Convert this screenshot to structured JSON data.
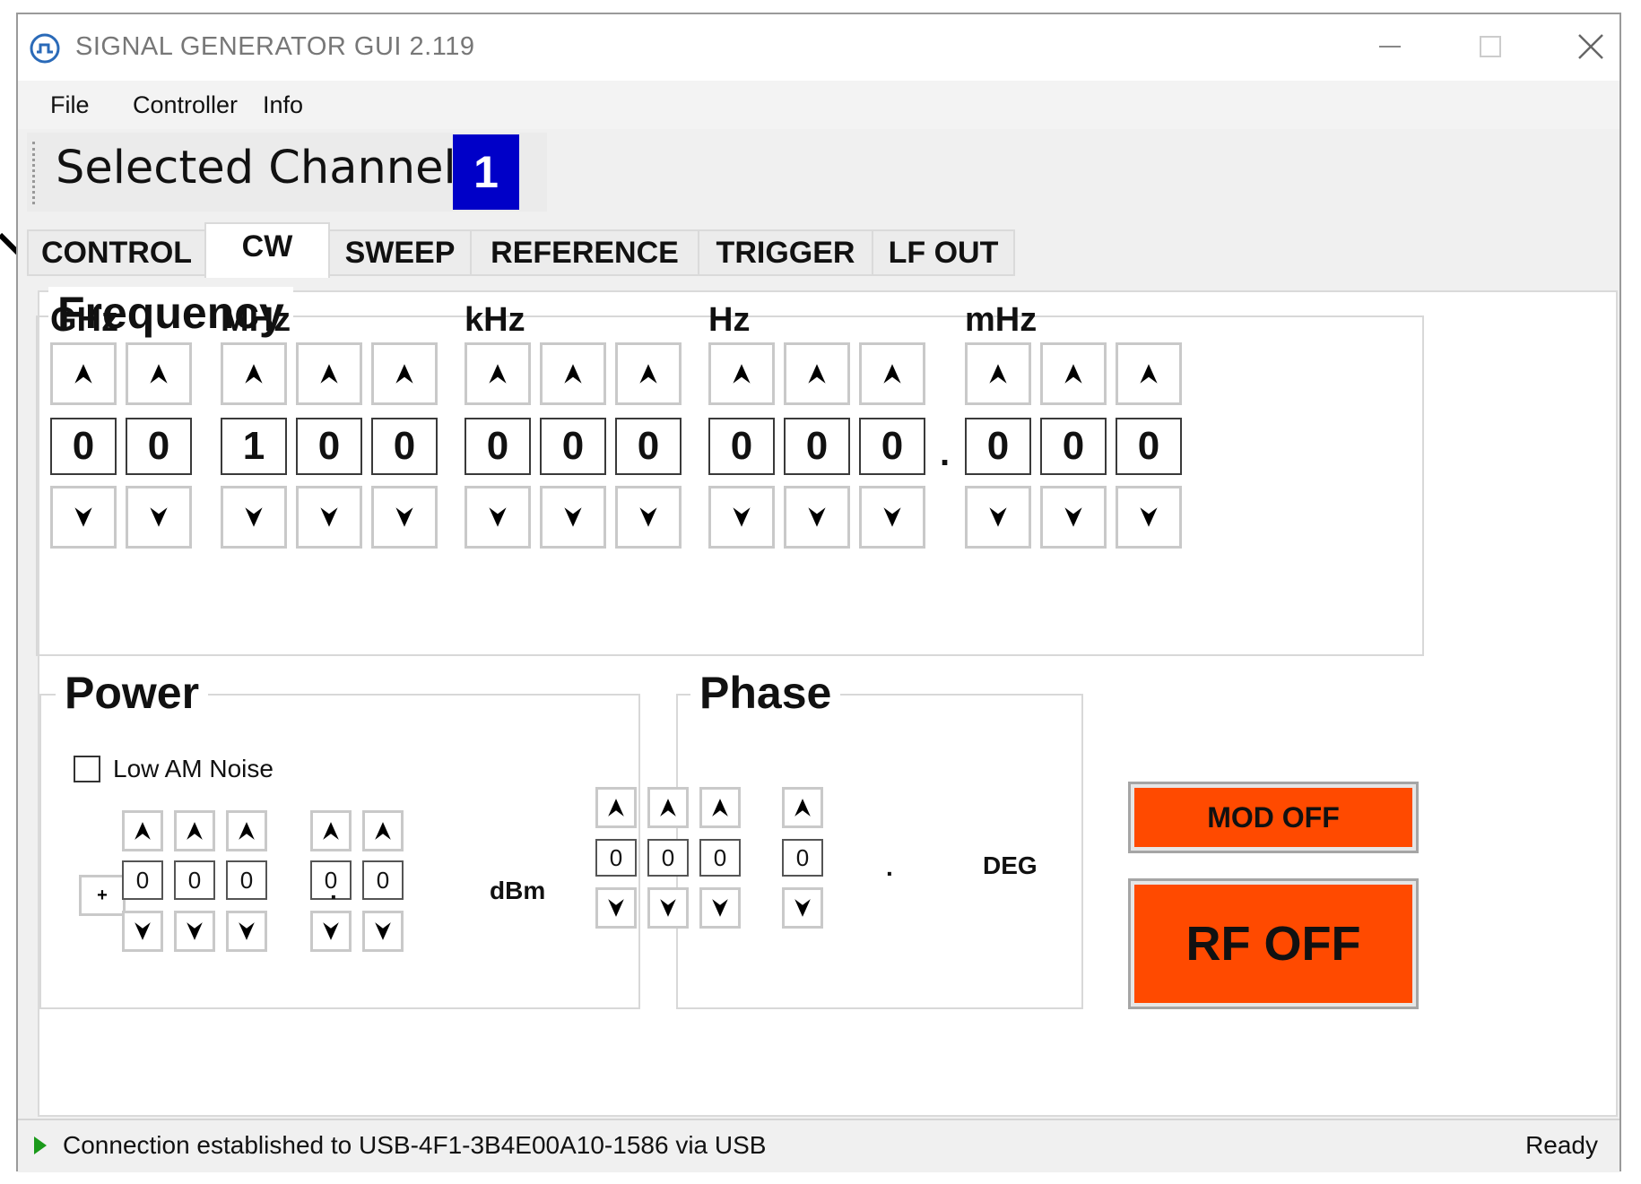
{
  "window": {
    "title": "SIGNAL GENERATOR GUI 2.119",
    "controls": [
      "minimize-icon",
      "maximize-icon",
      "close-icon"
    ]
  },
  "menu": [
    "File",
    "Controller",
    "Info"
  ],
  "channel": {
    "label": "Selected Channel:",
    "value": "1",
    "accent": "#0000c8"
  },
  "tabs": [
    "CONTROL",
    "CW",
    "SWEEP",
    "REFERENCE",
    "TRIGGER",
    "LF OUT"
  ],
  "active_tab": "CW",
  "frequency": {
    "title": "Frequency",
    "units": [
      "GHz",
      "MHz",
      "kHz",
      "Hz",
      "mHz"
    ],
    "digits": [
      [
        "0",
        "0"
      ],
      [
        "1",
        "0",
        "0"
      ],
      [
        "0",
        "0",
        "0"
      ],
      [
        "0",
        "0",
        "0"
      ],
      [
        "0",
        "0",
        "0"
      ]
    ],
    "decimal_point": "."
  },
  "power": {
    "title": "Power",
    "low_am_noise_label": "Low AM Noise",
    "low_am_noise_checked": false,
    "sign": "+",
    "digits": [
      "0",
      "0",
      "0"
    ],
    "decimal_point": ".",
    "fraction_digits": [
      "0",
      "0"
    ],
    "unit": "dBm"
  },
  "phase": {
    "title": "Phase",
    "digits": [
      "0",
      "0",
      "0"
    ],
    "decimal_point": ".",
    "fraction_digits": [
      "0"
    ],
    "unit": "DEG"
  },
  "buttons": {
    "mod": "MOD OFF",
    "rf": "RF OFF",
    "color": "#ff4a00"
  },
  "status": {
    "message": "Connection established to USB-4F1-3B4E00A10-1586 via USB",
    "state": "Ready"
  }
}
